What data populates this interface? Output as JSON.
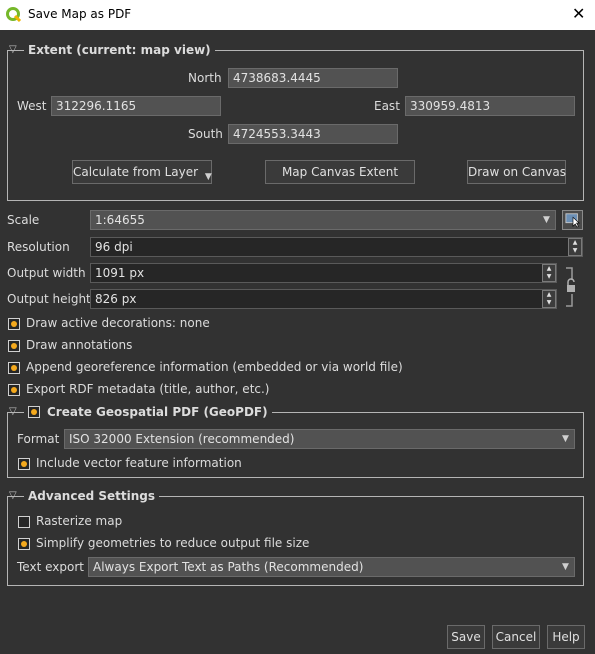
{
  "window": {
    "title": "Save Map as PDF",
    "close_glyph": "✕"
  },
  "extent": {
    "legend": "Extent (current: map view)",
    "north_label": "North",
    "north_value": "4738683.4445",
    "west_label": "West",
    "west_value": "312296.1165",
    "east_label": "East",
    "east_value": "330959.4813",
    "south_label": "South",
    "south_value": "4724553.3443",
    "calc_layer_label": "Calculate from Layer",
    "canvas_extent_label": "Map Canvas Extent",
    "draw_canvas_label": "Draw on Canvas"
  },
  "scale": {
    "label": "Scale",
    "value": "1:64655"
  },
  "resolution": {
    "label": "Resolution",
    "value": "96 dpi"
  },
  "output_width": {
    "label": "Output width",
    "value": "1091 px"
  },
  "output_height": {
    "label": "Output height",
    "value": "826 px"
  },
  "options": {
    "decorations": "Draw active decorations: none",
    "annotations": "Draw annotations",
    "georef": "Append georeference information (embedded or via world file)",
    "rdf": "Export RDF metadata (title, author, etc.)"
  },
  "geopdf": {
    "legend": "Create Geospatial PDF (GeoPDF)",
    "format_label": "Format",
    "format_value": "ISO 32000 Extension (recommended)",
    "vector_info": "Include vector feature information"
  },
  "advanced": {
    "legend": "Advanced Settings",
    "rasterize": "Rasterize map",
    "simplify": "Simplify geometries to reduce output file size",
    "text_export_label": "Text export",
    "text_export_value": "Always Export Text as Paths (Recommended)"
  },
  "footer": {
    "save": "Save",
    "cancel": "Cancel",
    "help": "Help"
  },
  "colors": {
    "accent": "#f4a91d",
    "background": "#323232",
    "qgis_green": "#76b82a"
  }
}
